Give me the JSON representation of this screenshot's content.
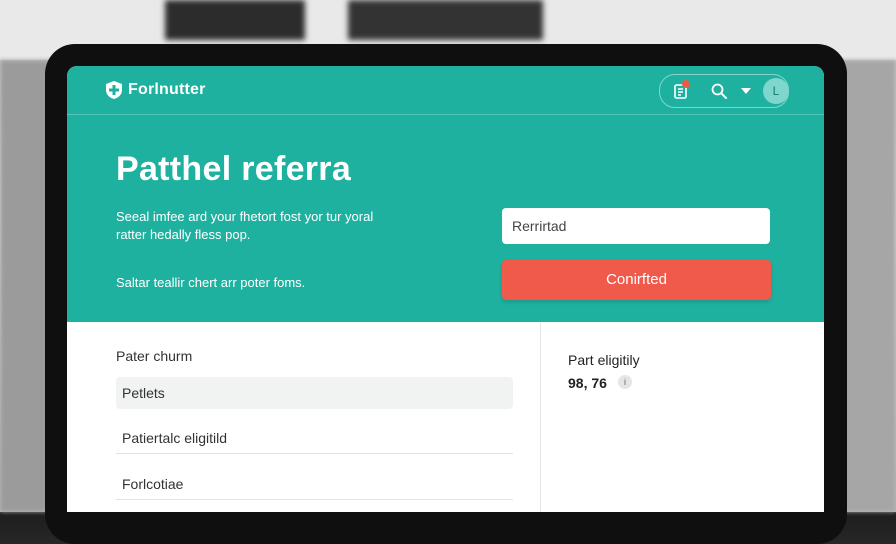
{
  "app": {
    "brand_name": "Forlnutter",
    "avatar_initial": "L"
  },
  "hero": {
    "title": "Patthel referra",
    "description": "Seeal imfee ard your fhetort fost yor tur yoral ratter hedally fless pop.",
    "note": "Saltar teallir chert arr poter foms."
  },
  "form": {
    "referral_value": "Rerrirtad",
    "confirm_label": "Conirfted"
  },
  "list": {
    "title": "Pater churm",
    "items": [
      "Petlets",
      "Patiertalc eligitild",
      "Forlcotiae"
    ]
  },
  "eligibility": {
    "title": "Part eligitily",
    "value": "98, 76"
  },
  "icons": {
    "brand": "shield-plus-icon",
    "notifications": "clipboard-bell-icon",
    "search": "search-icon",
    "menu": "chevron-down-icon",
    "info": "info-icon"
  },
  "colors": {
    "primary": "#1fb1a0",
    "accent": "#ef5a4b"
  }
}
